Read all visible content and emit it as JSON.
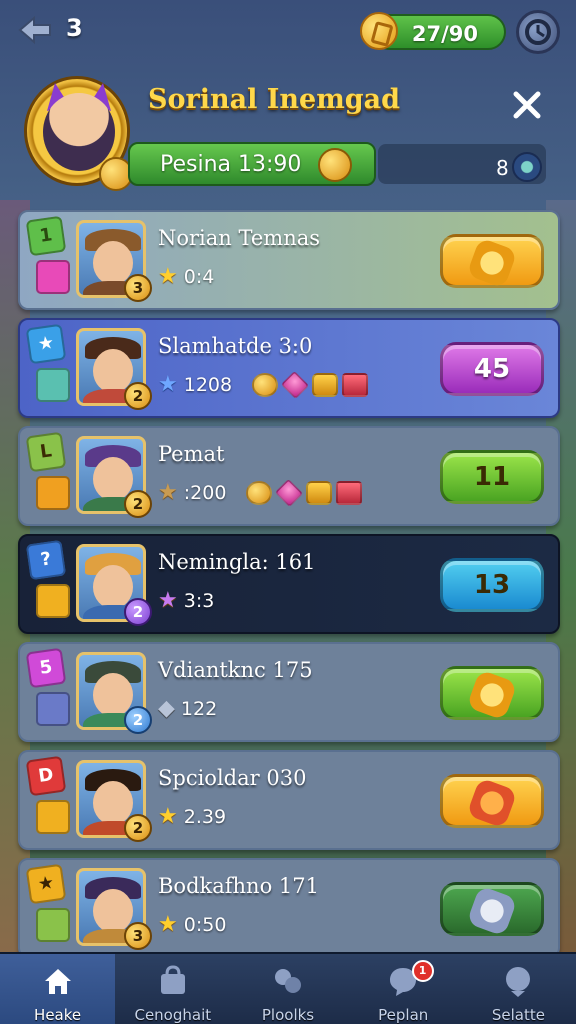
{
  "header": {
    "level": "3",
    "coins": "27/90"
  },
  "profile": {
    "name": "Sorinal Inemgad",
    "points": "Pesina 13:90",
    "gems": "8"
  },
  "rows": [
    {
      "badge": "1",
      "name": "Norian Temnas",
      "level": "3",
      "score": "0:4",
      "button": ""
    },
    {
      "badge": "",
      "name": "Slamhatde 3:0",
      "level": "2",
      "score": "1208",
      "button": "45"
    },
    {
      "badge": "L",
      "name": "Pemat",
      "level": "2",
      "score": ":200",
      "button": "11"
    },
    {
      "badge": "?",
      "name": "Nemingla: 161",
      "level": "2",
      "score": "3:3",
      "button": "13"
    },
    {
      "badge": "5",
      "name": "Vdiantknc 175",
      "level": "2",
      "score": "122",
      "button": ""
    },
    {
      "badge": "D",
      "name": "Spcioldar 030",
      "level": "2",
      "score": "2.39",
      "button": ""
    },
    {
      "badge": "",
      "name": "Bodkafhno 171",
      "level": "3",
      "score": "0:50",
      "button": ""
    }
  ],
  "nav": [
    {
      "label": "Heake",
      "icon": "home-icon"
    },
    {
      "label": "Cenoghait",
      "icon": "shop-icon"
    },
    {
      "label": "Ploolks",
      "icon": "puzzle-icon"
    },
    {
      "label": "Peplan",
      "icon": "chat-icon",
      "badge": "1"
    },
    {
      "label": "Selatte",
      "icon": "globe-icon"
    }
  ]
}
